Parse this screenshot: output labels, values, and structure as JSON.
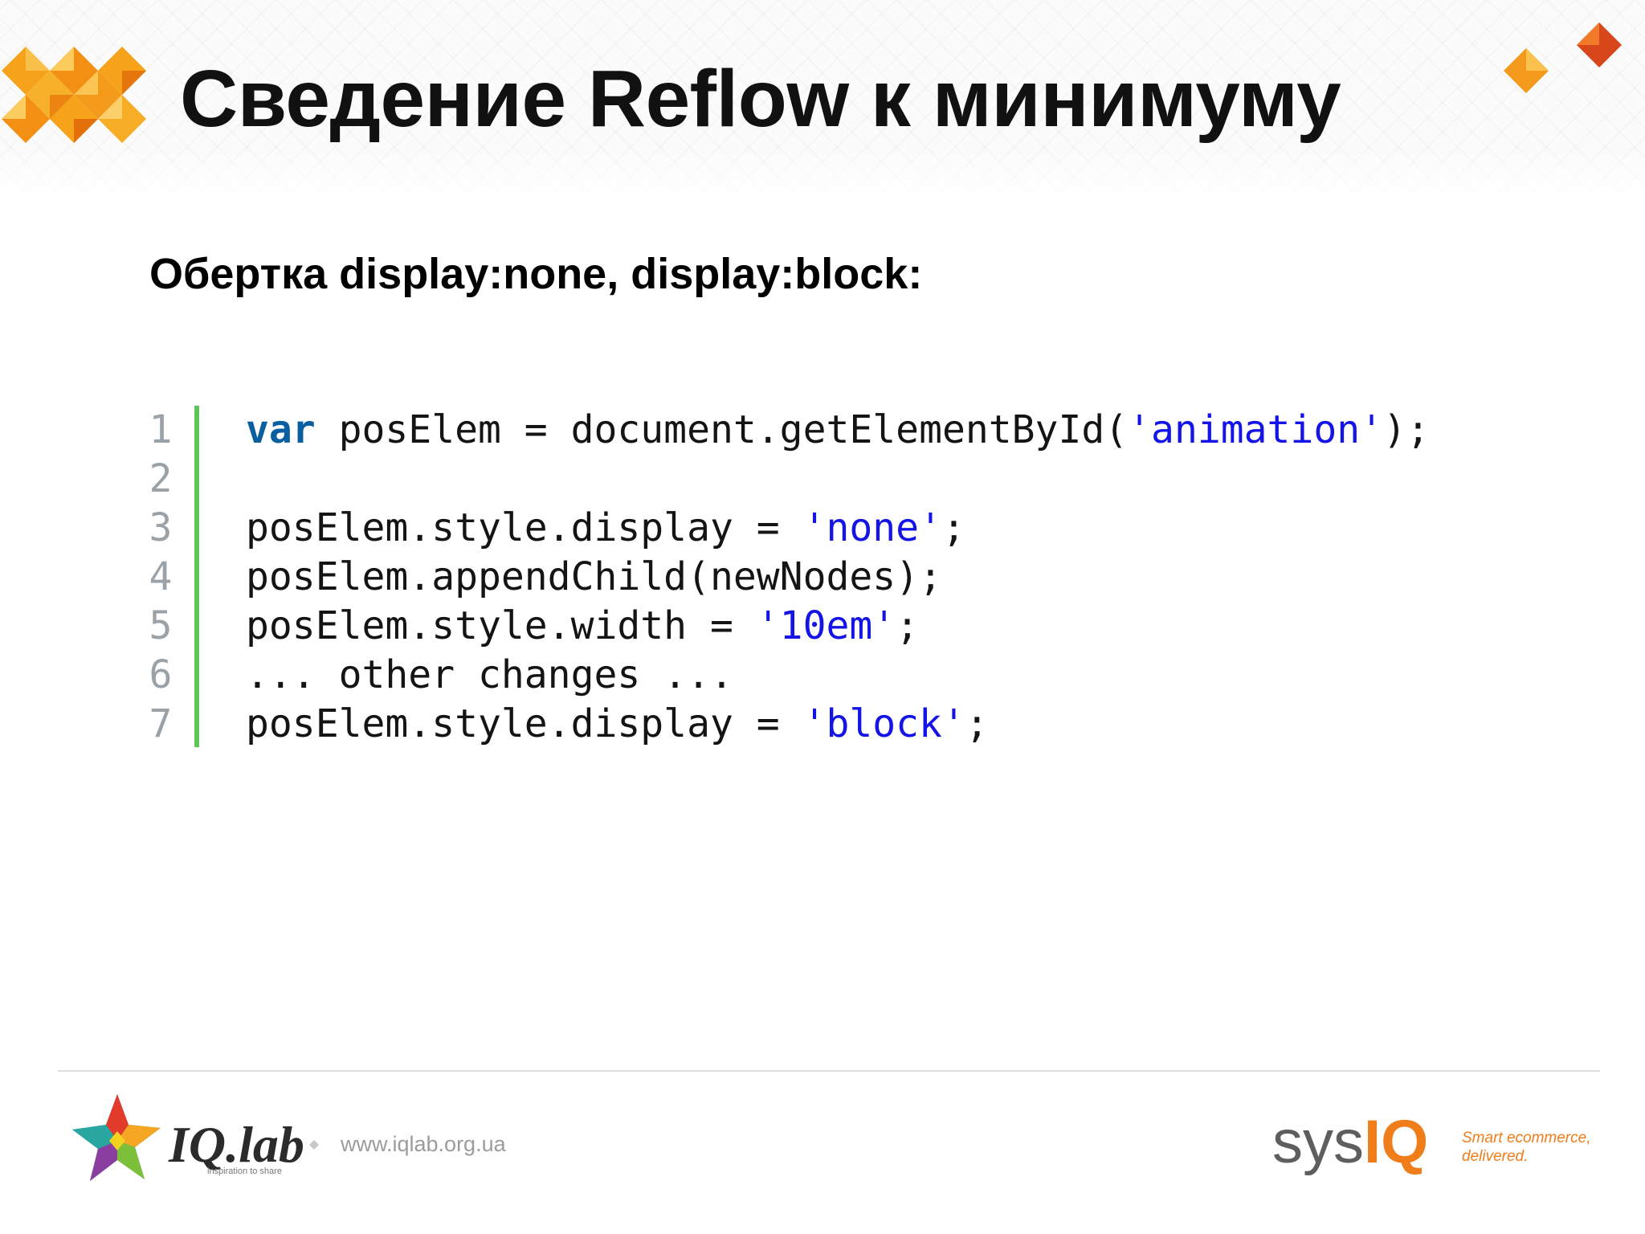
{
  "slide": {
    "title": "Сведение Reflow к минимуму",
    "subtitle": "Обертка display:none, display:block:"
  },
  "code": {
    "lines": [
      {
        "number": "1",
        "parts": [
          {
            "type": "keyword",
            "text": "var"
          },
          {
            "type": "plain",
            "text": " posElem = document.getElementById("
          },
          {
            "type": "string",
            "text": "'animation'"
          },
          {
            "type": "plain",
            "text": ");"
          }
        ]
      },
      {
        "number": "2",
        "parts": []
      },
      {
        "number": "3",
        "parts": [
          {
            "type": "plain",
            "text": "posElem.style.display = "
          },
          {
            "type": "string",
            "text": "'none'"
          },
          {
            "type": "plain",
            "text": ";"
          }
        ]
      },
      {
        "number": "4",
        "parts": [
          {
            "type": "plain",
            "text": "posElem.appendChild(newNodes);"
          }
        ]
      },
      {
        "number": "5",
        "parts": [
          {
            "type": "plain",
            "text": "posElem.style.width = "
          },
          {
            "type": "string",
            "text": "'10em'"
          },
          {
            "type": "plain",
            "text": ";"
          }
        ]
      },
      {
        "number": "6",
        "parts": [
          {
            "type": "plain",
            "text": "... other changes ..."
          }
        ]
      },
      {
        "number": "7",
        "parts": [
          {
            "type": "plain",
            "text": "posElem.style.display = "
          },
          {
            "type": "string",
            "text": "'block'"
          },
          {
            "type": "plain",
            "text": ";"
          }
        ]
      }
    ]
  },
  "footer": {
    "iqlab_name": "IQ.lab",
    "iqlab_tagline": "inspiration to share",
    "website": "www.iqlab.org.ua",
    "sysiq_prefix": "sys",
    "sysiq_suffix": "IQ",
    "sysiq_tagline_1": "Smart ecommerce,",
    "sysiq_tagline_2": "delivered."
  },
  "icons": {
    "header_left": "orange-mosaic-logo-icon",
    "header_right": "orange-diamonds-icon",
    "iqlab": "iqlab-star-logo-icon",
    "separator": "small-diamond-icon"
  },
  "colors": {
    "accent_orange": "#ef7d1a",
    "code_bar_green": "#5dc55b",
    "keyword_blue": "#0a5fa0",
    "string_blue": "#1414e6",
    "line_number_gray": "#9aa2a8"
  }
}
